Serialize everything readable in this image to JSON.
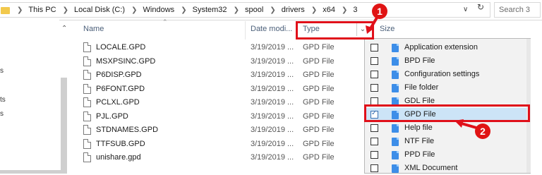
{
  "address": {
    "breadcrumbs": [
      "This PC",
      "Local Disk (C:)",
      "Windows",
      "System32",
      "spool",
      "drivers",
      "x64",
      "3"
    ],
    "search_placeholder": "Search 3"
  },
  "nav_fragments": [
    "s",
    "ts",
    "s"
  ],
  "columns": {
    "name": "Name",
    "date": "Date modi...",
    "type": "Type",
    "size": "Size"
  },
  "files": [
    {
      "name": "LOCALE.GPD",
      "date": "3/19/2019 ...",
      "type": "GPD File"
    },
    {
      "name": "MSXPSINC.GPD",
      "date": "3/19/2019 ...",
      "type": "GPD File"
    },
    {
      "name": "P6DISP.GPD",
      "date": "3/19/2019 ...",
      "type": "GPD File"
    },
    {
      "name": "P6FONT.GPD",
      "date": "3/19/2019 ...",
      "type": "GPD File"
    },
    {
      "name": "PCLXL.GPD",
      "date": "3/19/2019 ...",
      "type": "GPD File"
    },
    {
      "name": "PJL.GPD",
      "date": "3/19/2019 ...",
      "type": "GPD File"
    },
    {
      "name": "STDNAMES.GPD",
      "date": "3/19/2019 ...",
      "type": "GPD File"
    },
    {
      "name": "TTFSUB.GPD",
      "date": "3/19/2019 ...",
      "type": "GPD File"
    },
    {
      "name": "unishare.gpd",
      "date": "3/19/2019 ...",
      "type": "GPD File"
    }
  ],
  "filter_options": [
    {
      "label": "Application extension",
      "checked": false
    },
    {
      "label": "BPD File",
      "checked": false
    },
    {
      "label": "Configuration settings",
      "checked": false
    },
    {
      "label": "File folder",
      "checked": false
    },
    {
      "label": "GDL File",
      "checked": false
    },
    {
      "label": "GPD File",
      "checked": true
    },
    {
      "label": "Help file",
      "checked": false
    },
    {
      "label": "NTF File",
      "checked": false
    },
    {
      "label": "PPD File",
      "checked": false
    },
    {
      "label": "XML Document",
      "checked": false
    }
  ],
  "annotations": {
    "badge_1": "1",
    "badge_2": "2",
    "color": "#e0101a"
  },
  "icons": {
    "folder": "folder-icon",
    "file": "document-icon",
    "filter_item": "file-type-icon"
  }
}
